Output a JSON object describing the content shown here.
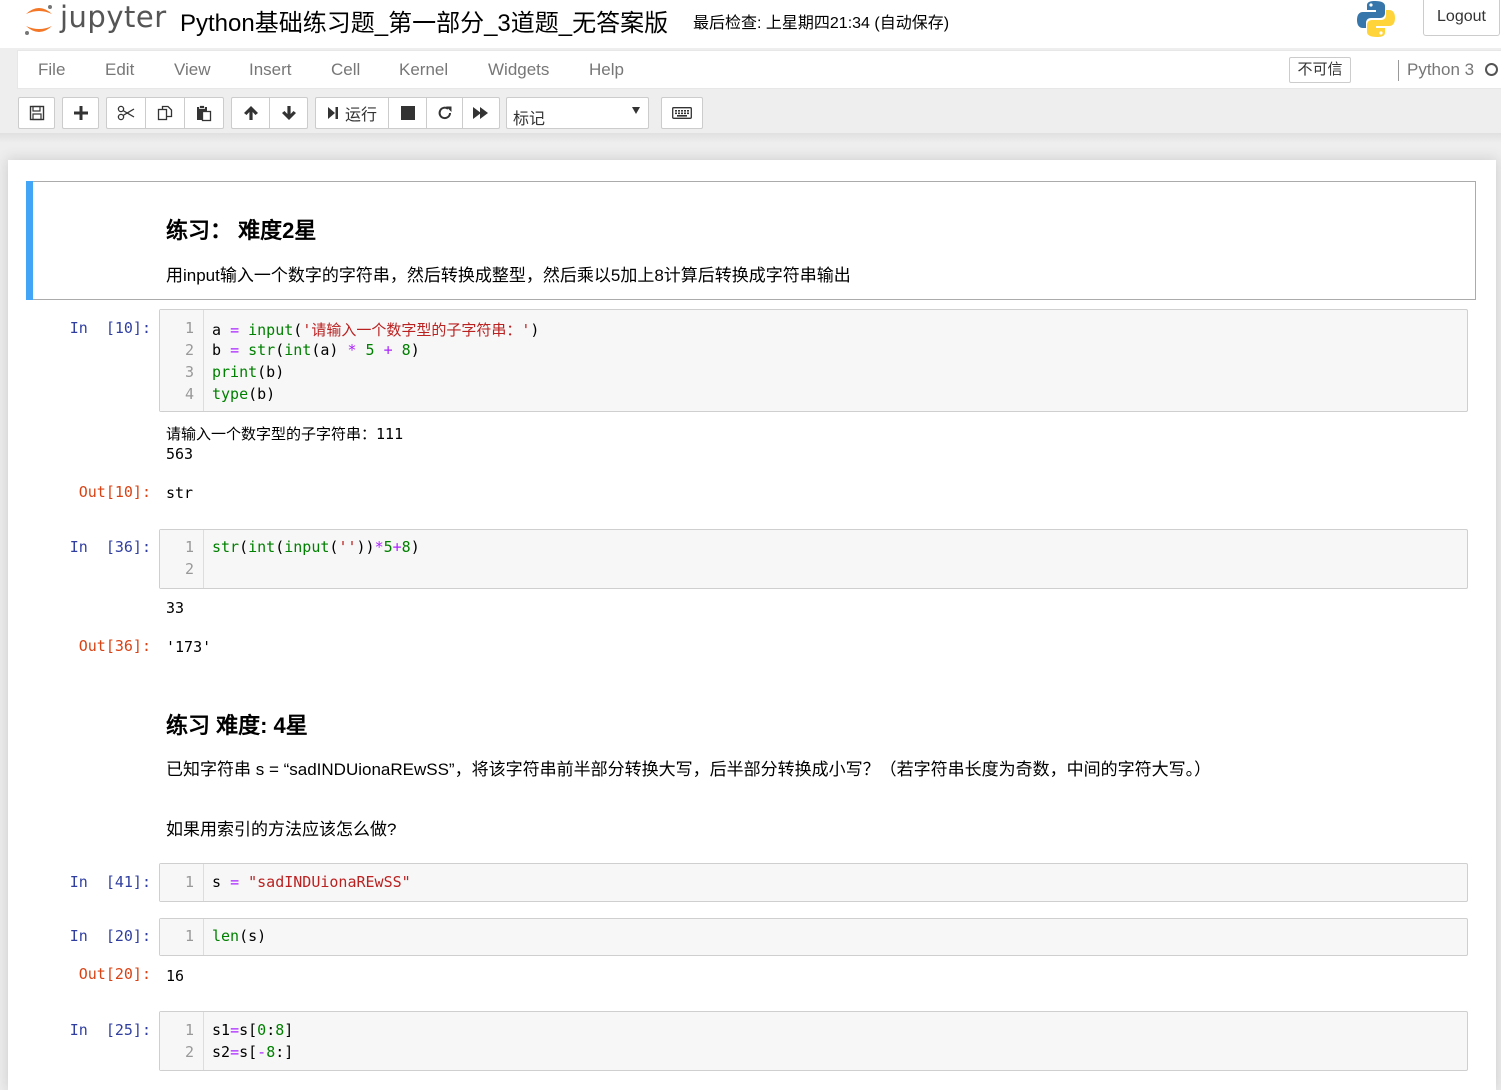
{
  "header": {
    "logo_text": "jupyter",
    "notebook_title": "Python基础练习题_第一部分_3道题_无答案版",
    "checkpoint": "最后检查: 上星期四21:34  (自动保存)",
    "logout_label": "Logout"
  },
  "menu": {
    "items": [
      "File",
      "Edit",
      "View",
      "Insert",
      "Cell",
      "Kernel",
      "Widgets",
      "Help"
    ],
    "trust_label": "不可信",
    "kernel_name": "Python 3"
  },
  "toolbar": {
    "run_label": "运行",
    "cell_type": "标记"
  },
  "cells": {
    "md1": {
      "heading": "练习： 难度2星",
      "text": "用input输入一个数字的字符串，然后转换成整型，然后乘以5加上8计算后转换成字符串输出"
    },
    "c1": {
      "prompt": "In  [10]:",
      "lines": [
        {
          "n": "1",
          "parts": [
            [
              "v",
              "a "
            ],
            [
              "o",
              "="
            ],
            [
              "v",
              " "
            ],
            [
              "k",
              "input"
            ],
            [
              "v",
              "("
            ],
            [
              "s",
              "'请输入一个数字型的子字符串：'"
            ],
            [
              "v",
              ")"
            ]
          ]
        },
        {
          "n": "2",
          "parts": [
            [
              "v",
              "b "
            ],
            [
              "o",
              "="
            ],
            [
              "v",
              " "
            ],
            [
              "k",
              "str"
            ],
            [
              "v",
              "("
            ],
            [
              "k",
              "int"
            ],
            [
              "v",
              "(a) "
            ],
            [
              "o",
              "*"
            ],
            [
              "v",
              " "
            ],
            [
              "num",
              "5"
            ],
            [
              "v",
              " "
            ],
            [
              "o",
              "+"
            ],
            [
              "v",
              " "
            ],
            [
              "num",
              "8"
            ],
            [
              "v",
              ")"
            ]
          ]
        },
        {
          "n": "3",
          "parts": [
            [
              "k",
              "print"
            ],
            [
              "v",
              "(b)"
            ]
          ]
        },
        {
          "n": "4",
          "parts": [
            [
              "k",
              "type"
            ],
            [
              "v",
              "(b)"
            ]
          ]
        }
      ],
      "stream": [
        "请输入一个数字型的子字符串：111",
        "563"
      ],
      "out_prompt": "Out[10]:",
      "out_text": "str"
    },
    "c2": {
      "prompt": "In  [36]:",
      "lines": [
        {
          "n": "1",
          "parts": [
            [
              "k",
              "str"
            ],
            [
              "v",
              "("
            ],
            [
              "k",
              "int"
            ],
            [
              "v",
              "("
            ],
            [
              "k",
              "input"
            ],
            [
              "v",
              "("
            ],
            [
              "s",
              "''"
            ],
            [
              "v",
              "))"
            ],
            [
              "o",
              "*"
            ],
            [
              "num",
              "5"
            ],
            [
              "o",
              "+"
            ],
            [
              "num",
              "8"
            ],
            [
              "v",
              ")"
            ]
          ]
        },
        {
          "n": "2",
          "parts": []
        }
      ],
      "stream": [
        "33"
      ],
      "out_prompt": "Out[36]:",
      "out_text": "'173'"
    },
    "md2": {
      "heading": "练习 难度: 4星",
      "text1": "已知字符串 s = “sadINDUionaREwSS”，将该字符串前半部分转换大写，后半部分转换成小写？（若字符串长度为奇数，中间的字符大写。）",
      "text2": "如果用索引的方法应该怎么做?"
    },
    "c3": {
      "prompt": "In  [41]:",
      "lines": [
        {
          "n": "1",
          "parts": [
            [
              "v",
              "s "
            ],
            [
              "o",
              "="
            ],
            [
              "v",
              " "
            ],
            [
              "s",
              "\"sadINDUionaREwSS\""
            ]
          ]
        }
      ]
    },
    "c4": {
      "prompt": "In  [20]:",
      "lines": [
        {
          "n": "1",
          "parts": [
            [
              "k",
              "len"
            ],
            [
              "v",
              "(s)"
            ]
          ]
        }
      ],
      "out_prompt": "Out[20]:",
      "out_text": "16"
    },
    "c5": {
      "prompt": "In  [25]:",
      "lines": [
        {
          "n": "1",
          "parts": [
            [
              "v",
              "s1"
            ],
            [
              "o",
              "="
            ],
            [
              "v",
              "s["
            ],
            [
              "num",
              "0"
            ],
            [
              "v",
              ":"
            ],
            [
              "num",
              "8"
            ],
            [
              "v",
              "]"
            ]
          ]
        },
        {
          "n": "2",
          "parts": [
            [
              "v",
              "s2"
            ],
            [
              "o",
              "="
            ],
            [
              "v",
              "s["
            ],
            [
              "o",
              "-"
            ],
            [
              "num",
              "8"
            ],
            [
              "v",
              ":]"
            ]
          ]
        }
      ]
    }
  }
}
